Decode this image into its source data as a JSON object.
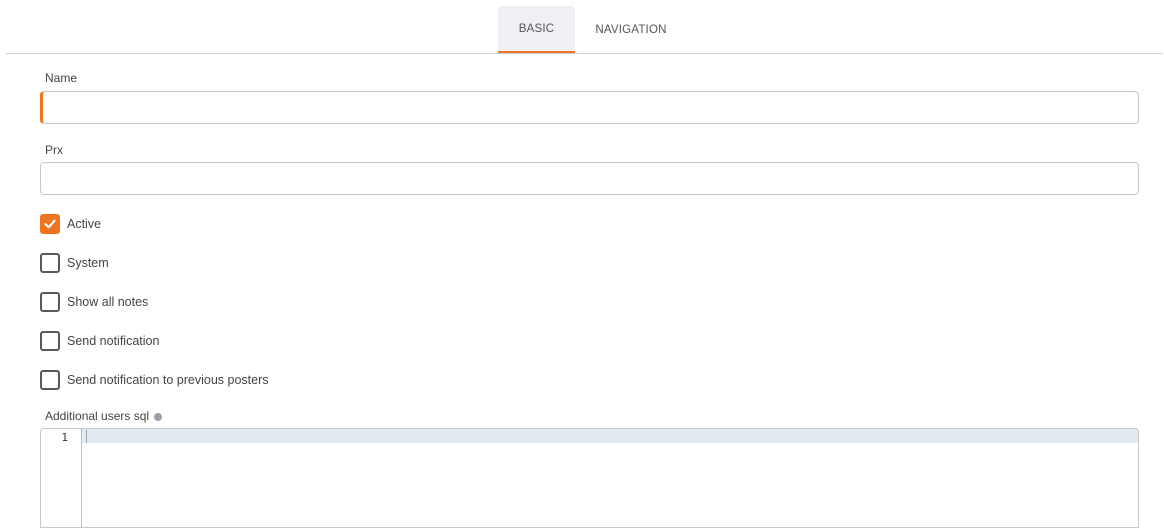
{
  "tabs": [
    {
      "label": "BASIC",
      "active": true
    },
    {
      "label": "NAVIGATION",
      "active": false
    }
  ],
  "form": {
    "name": {
      "label": "Name",
      "value": "",
      "placeholder": ""
    },
    "prx": {
      "label": "Prx",
      "value": "",
      "placeholder": ""
    },
    "checkboxes": [
      {
        "label": "Active",
        "checked": true
      },
      {
        "label": "System",
        "checked": false
      },
      {
        "label": "Show all notes",
        "checked": false
      },
      {
        "label": "Send notification",
        "checked": false
      },
      {
        "label": "Send notification to previous posters",
        "checked": false
      }
    ],
    "sql": {
      "label": "Additional users sql",
      "line_numbers": [
        "1"
      ],
      "value": ""
    }
  },
  "colors": {
    "accent": "#f07322",
    "tab_active_bg": "#eef0f3",
    "checkbox_border": "#56595e",
    "info_icon": "#9aa0aa",
    "editor_active_line": "#e3e9f0"
  },
  "icons": {
    "check": "check-icon",
    "info": "info-icon"
  }
}
